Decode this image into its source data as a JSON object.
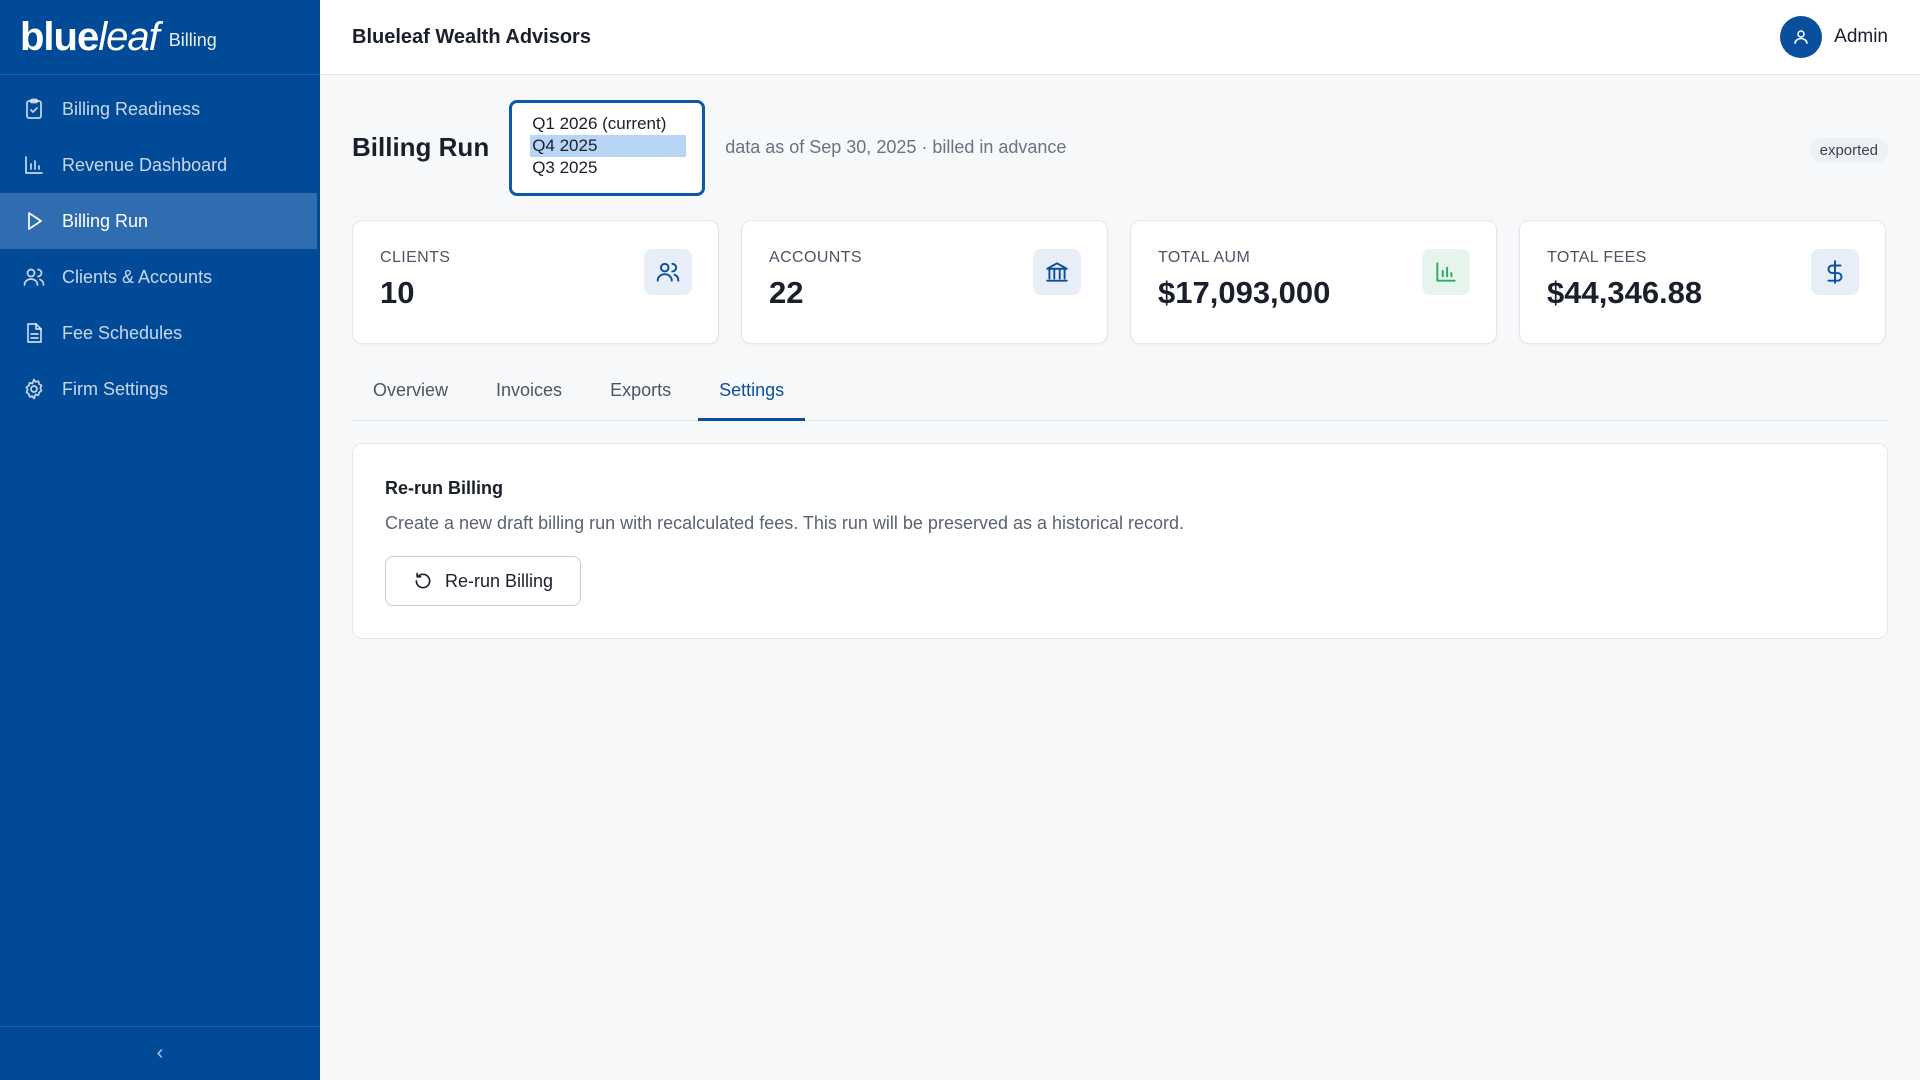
{
  "brand": {
    "logo_bold": "blue",
    "logo_light": "leaf",
    "subtitle": "Billing"
  },
  "sidebar": {
    "items": [
      {
        "label": "Billing Readiness",
        "icon": "clipboard-check-icon"
      },
      {
        "label": "Revenue Dashboard",
        "icon": "bar-chart-icon"
      },
      {
        "label": "Billing Run",
        "icon": "play-icon",
        "active": true
      },
      {
        "label": "Clients & Accounts",
        "icon": "users-icon"
      },
      {
        "label": "Fee Schedules",
        "icon": "document-icon"
      },
      {
        "label": "Firm Settings",
        "icon": "gear-icon"
      }
    ],
    "collapse_glyph": "‹"
  },
  "header": {
    "firm_name": "Blueleaf Wealth Advisors",
    "user_name": "Admin"
  },
  "page": {
    "title": "Billing Run",
    "period_options": [
      "Q1 2026 (current)",
      "Q4 2025",
      "Q3 2025"
    ],
    "period_selected": "Q4 2025",
    "as_of": "data as of Sep 30, 2025 · billed in advance",
    "status": "exported"
  },
  "kpis": [
    {
      "label": "CLIENTS",
      "value": "10",
      "icon": "users-icon"
    },
    {
      "label": "ACCOUNTS",
      "value": "22",
      "icon": "bank-icon"
    },
    {
      "label": "TOTAL AUM",
      "value": "$17,093,000",
      "icon": "bar-chart-icon"
    },
    {
      "label": "TOTAL FEES",
      "value": "$44,346.88",
      "icon": "dollar-icon"
    }
  ],
  "tabs": [
    "Overview",
    "Invoices",
    "Exports",
    "Settings"
  ],
  "active_tab": "Settings",
  "settings": {
    "title": "Re-run Billing",
    "description": "Create a new draft billing run with recalculated fees. This run will be preserved as a historical record.",
    "button_label": "Re-run Billing"
  },
  "colors": {
    "sidebar_bg": "#004a98",
    "active_nav": "#2f6cb0",
    "accent": "#0a4f9e",
    "green": "#2eaa62"
  }
}
